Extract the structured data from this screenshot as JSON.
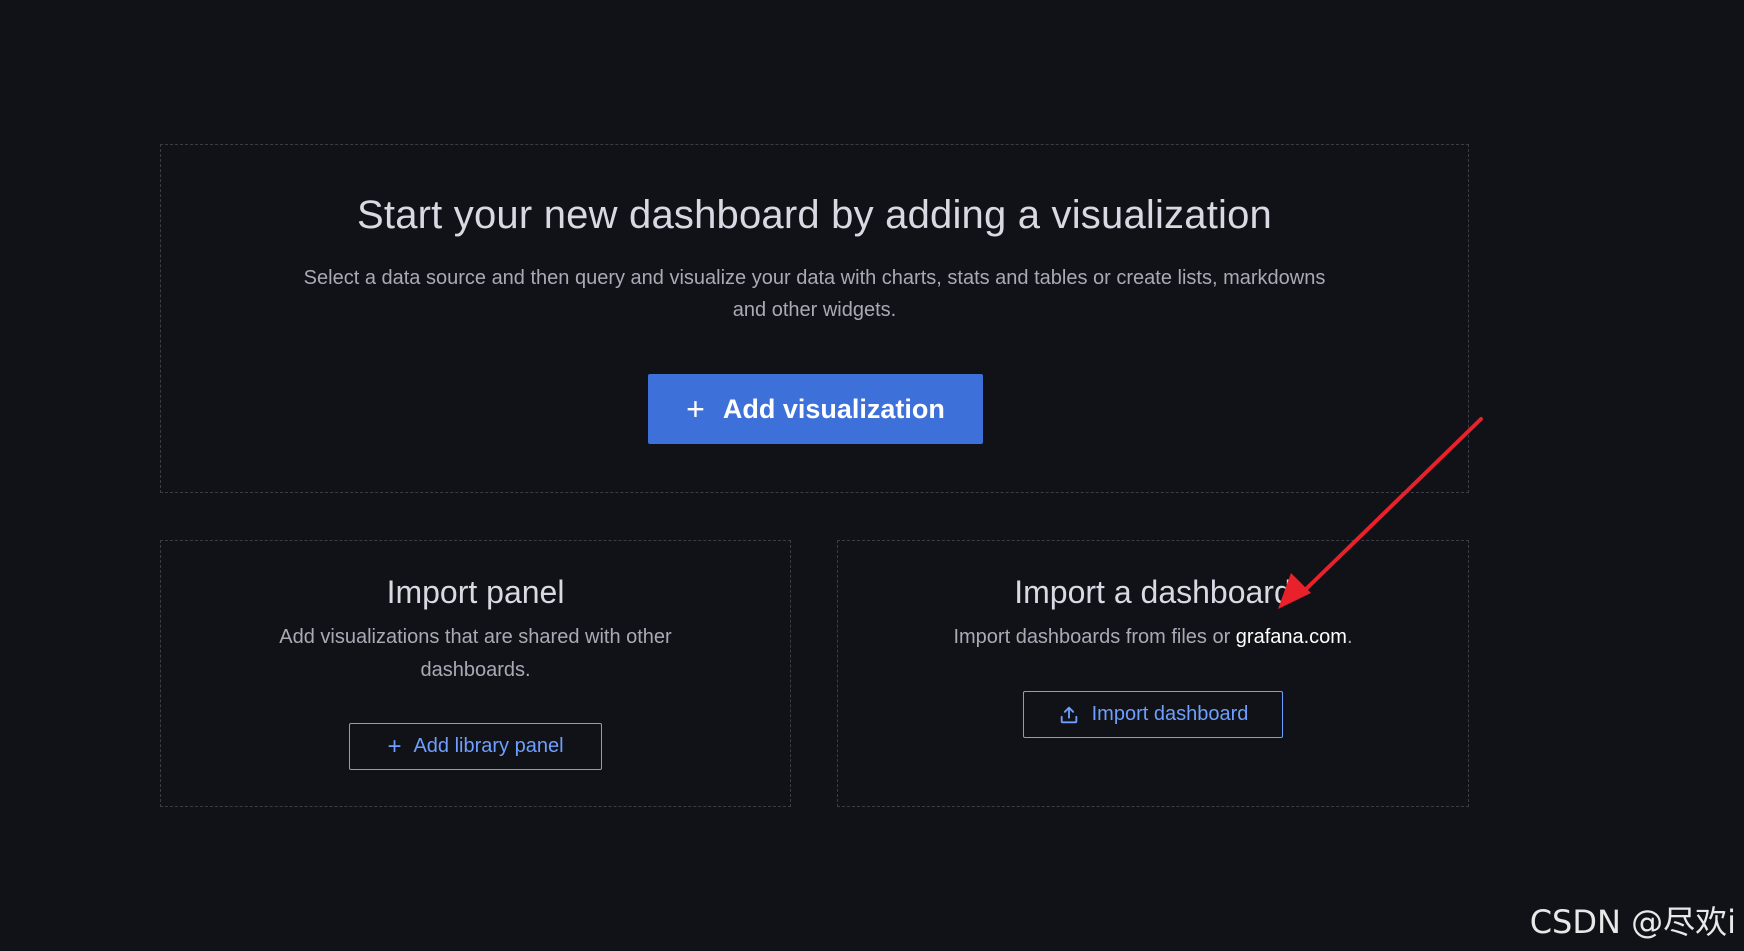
{
  "main": {
    "title": "Start your new dashboard by adding a visualization",
    "description": "Select a data source and then query and visualize your data with charts, stats and tables or create lists, markdowns and other widgets.",
    "add_visualization_label": "Add visualization"
  },
  "import_panel": {
    "title": "Import panel",
    "description": "Add visualizations that are shared with other dashboards.",
    "button_label": "Add library panel"
  },
  "import_dashboard": {
    "title": "Import a dashboard",
    "description_prefix": "Import dashboards from files or ",
    "link_text": "grafana.com",
    "description_suffix": ".",
    "button_label": "Import dashboard"
  },
  "annotation": {
    "arrow_color": "#e8212b"
  },
  "watermark": "CSDN @尽欢i",
  "colors": {
    "background": "#111217",
    "primary": "#3d71d9",
    "outline_accent": "#6e9fff"
  }
}
